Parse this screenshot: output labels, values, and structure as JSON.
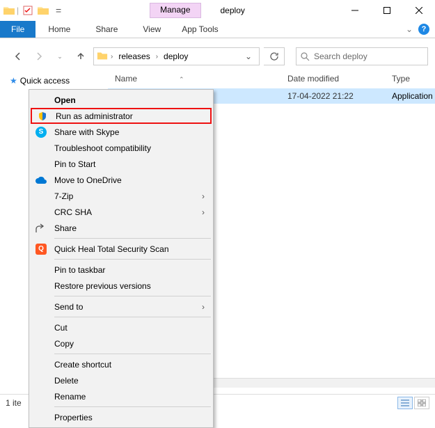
{
  "titlebar": {
    "manage_label": "Manage",
    "window_title": "deploy"
  },
  "ribbon": {
    "file": "File",
    "home": "Home",
    "share": "Share",
    "view": "View",
    "app_tools": "App Tools"
  },
  "nav": {
    "breadcrumb": [
      "releases",
      "deploy"
    ],
    "search_placeholder": "Search deploy"
  },
  "columns": {
    "name": "Name",
    "date": "Date modified",
    "type": "Type"
  },
  "row": {
    "date": "17-04-2022 21:22",
    "type": "Application"
  },
  "sidebar": {
    "quick_access": "Quick access"
  },
  "status": {
    "text": "1 ite"
  },
  "context_menu": {
    "open": "Open",
    "run_as_admin": "Run as administrator",
    "share_skype": "Share with Skype",
    "troubleshoot": "Troubleshoot compatibility",
    "pin_start": "Pin to Start",
    "move_onedrive": "Move to OneDrive",
    "seven_zip": "7-Zip",
    "crc_sha": "CRC SHA",
    "share": "Share",
    "quick_heal": "Quick Heal Total Security Scan",
    "pin_taskbar": "Pin to taskbar",
    "restore_prev": "Restore previous versions",
    "send_to": "Send to",
    "cut": "Cut",
    "copy": "Copy",
    "create_shortcut": "Create shortcut",
    "delete": "Delete",
    "rename": "Rename",
    "properties": "Properties"
  }
}
